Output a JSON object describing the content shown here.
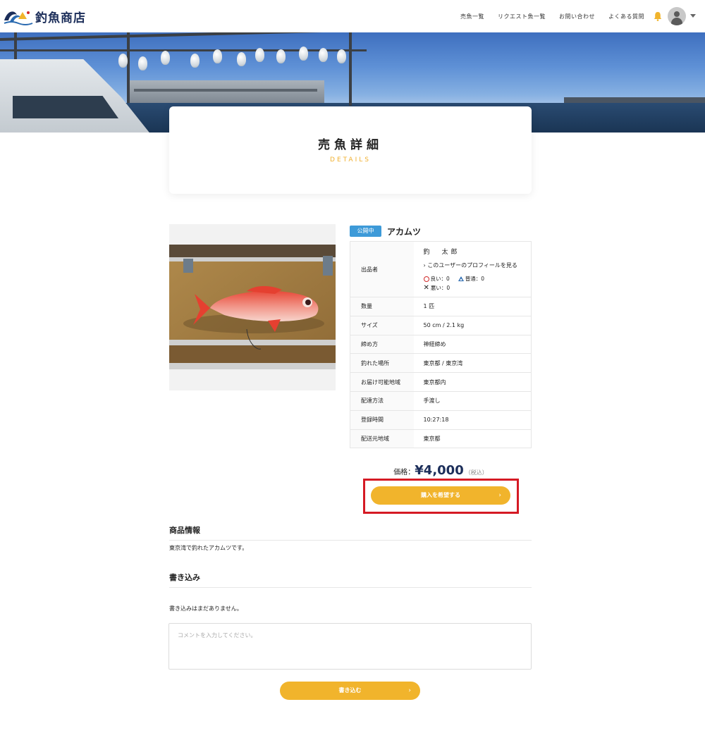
{
  "brand": {
    "logo_text": "釣魚商店"
  },
  "nav": {
    "items": [
      "売魚一覧",
      "リクエスト魚一覧",
      "お問い合わせ",
      "よくある質問"
    ]
  },
  "page_title": {
    "title": "売魚詳細",
    "subtitle": "DETAILS"
  },
  "listing": {
    "status": "公開中",
    "fish_name": "アカムツ",
    "seller_label": "出品者",
    "seller_name": "釣　太郎",
    "profile_link": "このユーザーのプロフィールを見る",
    "ratings": {
      "good": "良い：0",
      "normal": "普通：0",
      "bad": "悪い：0"
    },
    "rows": [
      {
        "key": "数量",
        "value": "1 匹"
      },
      {
        "key": "サイズ",
        "value": "50 cm / 2.1 kg"
      },
      {
        "key": "締め方",
        "value": "神経締め"
      },
      {
        "key": "釣れた場所",
        "value": "東京都 / 東京湾"
      },
      {
        "key": "お届け可能地域",
        "value": "東京都内"
      },
      {
        "key": "配達方法",
        "value": "手渡し"
      },
      {
        "key": "登録時間",
        "value": "10:27:18"
      },
      {
        "key": "配送元地域",
        "value": "東京都"
      }
    ]
  },
  "price": {
    "label": "価格：",
    "value": "¥4,000",
    "tax": "（税込）"
  },
  "buy_button": {
    "label": "購入を希望する",
    "chevron": "›"
  },
  "product_info": {
    "heading": "商品情報",
    "text": "東京湾で釣れたアカムツです。"
  },
  "comments": {
    "heading": "書き込み",
    "empty_text": "書き込みはまだありません。",
    "placeholder": "コメントを入力してください。",
    "submit_label": "書き込む",
    "chevron": "›"
  },
  "colors": {
    "accent": "#f1b42c",
    "navy": "#1c2e5a",
    "badge": "#3d9ad8",
    "highlight": "#d51a24"
  },
  "icons": [
    "wave-logo-icon",
    "bell-icon",
    "avatar-icon",
    "caret-down-icon",
    "chevron-right-icon",
    "circle-good-icon",
    "triangle-normal-icon",
    "cross-bad-icon"
  ]
}
